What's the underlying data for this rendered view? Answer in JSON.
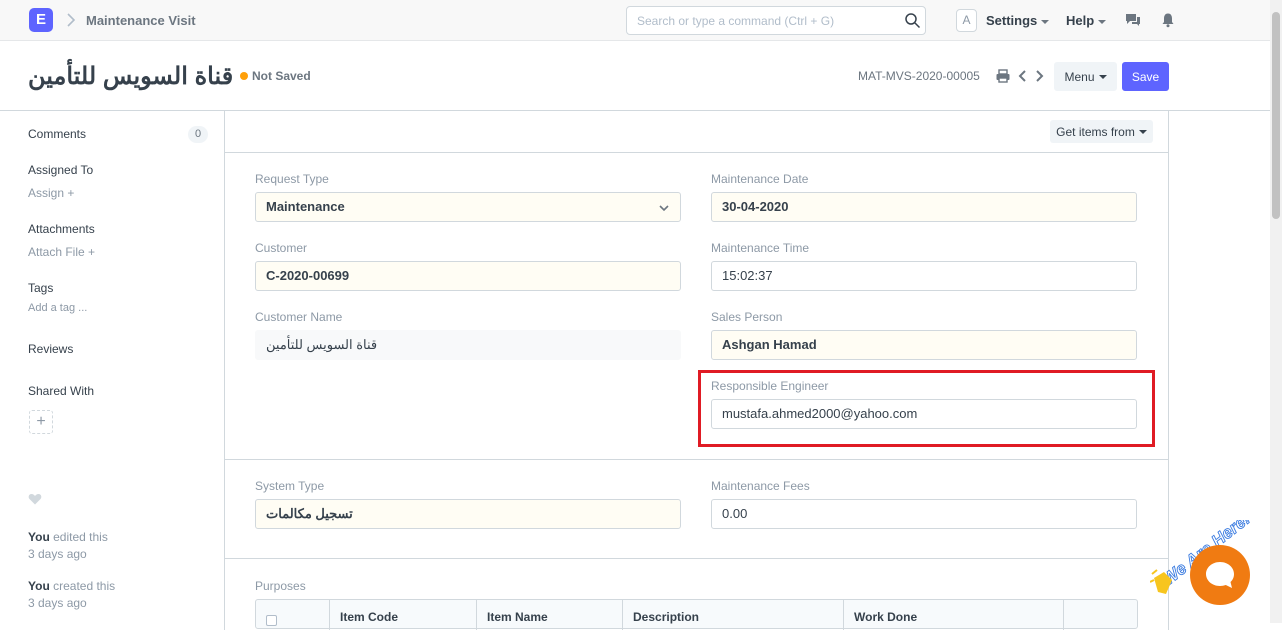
{
  "navbar": {
    "logo_letter": "E",
    "breadcrumb": "Maintenance Visit",
    "search_placeholder": "Search or type a command (Ctrl + G)",
    "avatar_letter": "A",
    "settings_label": "Settings",
    "help_label": "Help"
  },
  "page": {
    "title": "قناة السويس للتأمين",
    "status": "Not Saved",
    "doc_name": "MAT-MVS-2020-00005",
    "menu_label": "Menu",
    "save_label": "Save"
  },
  "sidebar": {
    "comments_label": "Comments",
    "comments_count": "0",
    "assigned_to_label": "Assigned To",
    "assign_label": "Assign",
    "attachments_label": "Attachments",
    "attach_file_label": "Attach File",
    "tags_label": "Tags",
    "add_tag_label": "Add a tag ...",
    "reviews_label": "Reviews",
    "shared_with_label": "Shared With",
    "activity": [
      {
        "actor": "You",
        "action": " edited this",
        "when": "3 days ago"
      },
      {
        "actor": "You",
        "action": " created this",
        "when": "3 days ago"
      }
    ]
  },
  "form": {
    "get_items_label": "Get items from",
    "request_type": {
      "label": "Request Type",
      "value": "Maintenance"
    },
    "maintenance_date": {
      "label": "Maintenance Date",
      "value": "30-04-2020"
    },
    "customer": {
      "label": "Customer",
      "value": "C-2020-00699"
    },
    "maintenance_time": {
      "label": "Maintenance Time",
      "value": "15:02:37"
    },
    "customer_name": {
      "label": "Customer Name",
      "value": "قناة السويس للتأمين"
    },
    "sales_person": {
      "label": "Sales Person",
      "value": "Ashgan Hamad"
    },
    "responsible_engineer": {
      "label": "Responsible Engineer",
      "value": "mustafa.ahmed2000@yahoo.com"
    },
    "system_type": {
      "label": "System Type",
      "value": "تسجيل مكالمات"
    },
    "maintenance_fees": {
      "label": "Maintenance Fees",
      "value": "0.00"
    },
    "purposes_label": "Purposes",
    "purposes_columns": [
      "Item Code",
      "Item Name",
      "Description",
      "Work Done"
    ]
  },
  "chat_widget": {
    "tagline": "We Are Here!"
  },
  "colors": {
    "primary": "#5e64ff",
    "warning": "#ffa00a",
    "highlight": "#e01b24",
    "chat": "#f07b12"
  }
}
